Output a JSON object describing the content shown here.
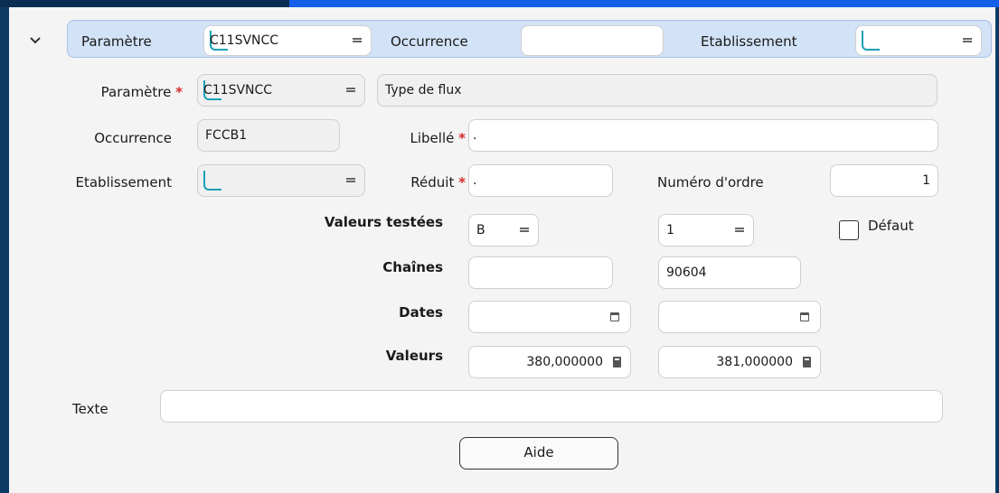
{
  "header": {
    "parametre_label": "Paramètre",
    "parametre_value": "C11SVNCC",
    "occurrence_label": "Occurrence",
    "occurrence_value": "",
    "etablissement_label": "Etablissement",
    "etablissement_value": ""
  },
  "form": {
    "parametre_label": "Paramètre",
    "parametre_value": "C11SVNCC",
    "parametre_desc": "Type de flux",
    "occurrence_label": "Occurrence",
    "occurrence_value": "FCCB1",
    "libelle_label": "Libellé",
    "libelle_value": ".",
    "etablissement_label": "Etablissement",
    "etablissement_value": "",
    "reduit_label": "Réduit",
    "reduit_value": ".",
    "numero_label": "Numéro d'ordre",
    "numero_value": "1",
    "valeurs_testees_label": "Valeurs testées",
    "valeurs_testees_1": "B",
    "valeurs_testees_2": "1",
    "defaut_label": "Défaut",
    "defaut_checked": false,
    "chaines_label": "Chaînes",
    "chaines_1": "",
    "chaines_2": "90604",
    "dates_label": "Dates",
    "dates_1": "",
    "dates_2": "",
    "valeurs_label": "Valeurs",
    "valeurs_1": "380,000000",
    "valeurs_2": "381,000000",
    "texte_label": "Texte",
    "texte_value": "",
    "required_mark": "*"
  },
  "buttons": {
    "aide": "Aide"
  },
  "colors": {
    "required": "#d62b2b",
    "header_bg": "#d2e2f7",
    "zoom_accent": "#1aa0b8"
  }
}
